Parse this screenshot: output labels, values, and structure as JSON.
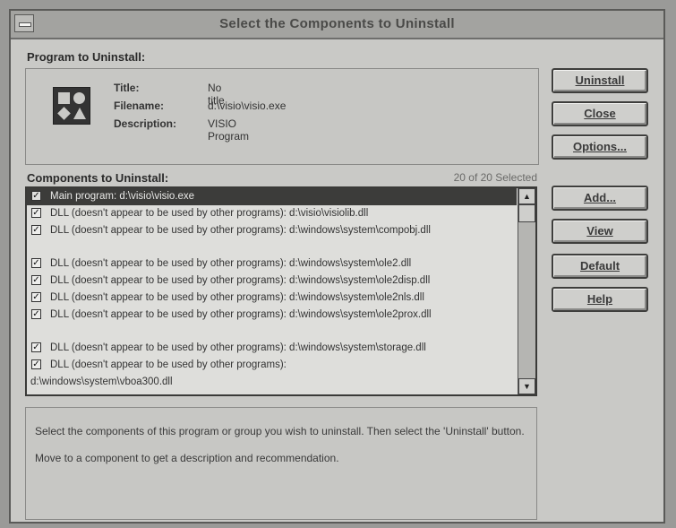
{
  "window": {
    "title": "Select the Components to Uninstall"
  },
  "program_section": {
    "label": "Program to Uninstall:",
    "title_key": "Title:",
    "title_value": "No title",
    "filename_key": "Filename:",
    "filename_value": "d:\\visio\\visio.exe",
    "description_key": "Description:",
    "description_value": "VISIO Program"
  },
  "buttons": {
    "uninstall": "Uninstall",
    "close": "Close",
    "options": "Options...",
    "add": "Add...",
    "view": "View",
    "default": "Default",
    "help": "Help"
  },
  "components": {
    "label": "Components to Uninstall:",
    "count": "20 of 20 Selected",
    "items": [
      {
        "text": "Main program: d:\\visio\\visio.exe",
        "checked": true,
        "selected": true
      },
      {
        "text": "DLL (doesn't appear to be used by other programs): d:\\visio\\visiolib.dll",
        "checked": true
      },
      {
        "text": "DLL (doesn't appear to be used by other programs): d:\\windows\\system\\compobj.dll",
        "checked": true
      },
      {
        "text": "DLL (doesn't appear to be used by other programs): d:\\windows\\system\\ole2.dll",
        "checked": true
      },
      {
        "text": "DLL (doesn't appear to be used by other programs): d:\\windows\\system\\ole2disp.dll",
        "checked": true
      },
      {
        "text": "DLL (doesn't appear to be used by other programs): d:\\windows\\system\\ole2nls.dll",
        "checked": true
      },
      {
        "text": "DLL (doesn't appear to be used by other programs): d:\\windows\\system\\ole2prox.dll",
        "checked": true
      },
      {
        "text": "DLL (doesn't appear to be used by other programs): d:\\windows\\system\\storage.dll",
        "checked": true
      },
      {
        "text": "DLL (doesn't appear to be used by other programs):",
        "text2": "d:\\windows\\system\\vboa300.dll",
        "checked": true
      }
    ]
  },
  "description": {
    "line1": "Select the components of this program or group you wish to uninstall.  Then select the 'Uninstall' button.",
    "line2": "Move to a component to get a description and recommendation."
  },
  "icons": {
    "system_menu": "system-menu-icon",
    "app": "visio-app-icon",
    "checkbox": "checkbox-checked-icon",
    "scroll_up": "scroll-up-arrow-icon",
    "scroll_down": "scroll-down-arrow-icon"
  }
}
